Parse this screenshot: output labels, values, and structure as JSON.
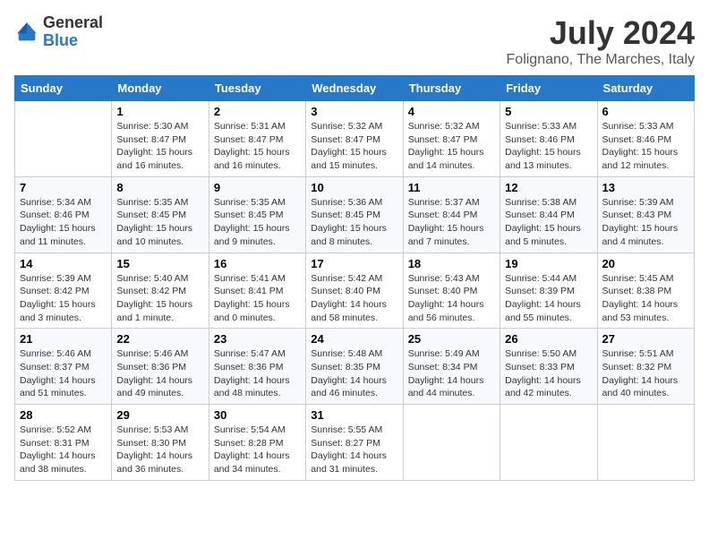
{
  "header": {
    "logo_general": "General",
    "logo_blue": "Blue",
    "month_year": "July 2024",
    "location": "Folignano, The Marches, Italy"
  },
  "weekdays": [
    "Sunday",
    "Monday",
    "Tuesday",
    "Wednesday",
    "Thursday",
    "Friday",
    "Saturday"
  ],
  "weeks": [
    [
      {
        "day": "",
        "sunrise": "",
        "sunset": "",
        "daylight": ""
      },
      {
        "day": "1",
        "sunrise": "Sunrise: 5:30 AM",
        "sunset": "Sunset: 8:47 PM",
        "daylight": "Daylight: 15 hours and 16 minutes."
      },
      {
        "day": "2",
        "sunrise": "Sunrise: 5:31 AM",
        "sunset": "Sunset: 8:47 PM",
        "daylight": "Daylight: 15 hours and 16 minutes."
      },
      {
        "day": "3",
        "sunrise": "Sunrise: 5:32 AM",
        "sunset": "Sunset: 8:47 PM",
        "daylight": "Daylight: 15 hours and 15 minutes."
      },
      {
        "day": "4",
        "sunrise": "Sunrise: 5:32 AM",
        "sunset": "Sunset: 8:47 PM",
        "daylight": "Daylight: 15 hours and 14 minutes."
      },
      {
        "day": "5",
        "sunrise": "Sunrise: 5:33 AM",
        "sunset": "Sunset: 8:46 PM",
        "daylight": "Daylight: 15 hours and 13 minutes."
      },
      {
        "day": "6",
        "sunrise": "Sunrise: 5:33 AM",
        "sunset": "Sunset: 8:46 PM",
        "daylight": "Daylight: 15 hours and 12 minutes."
      }
    ],
    [
      {
        "day": "7",
        "sunrise": "Sunrise: 5:34 AM",
        "sunset": "Sunset: 8:46 PM",
        "daylight": "Daylight: 15 hours and 11 minutes."
      },
      {
        "day": "8",
        "sunrise": "Sunrise: 5:35 AM",
        "sunset": "Sunset: 8:45 PM",
        "daylight": "Daylight: 15 hours and 10 minutes."
      },
      {
        "day": "9",
        "sunrise": "Sunrise: 5:35 AM",
        "sunset": "Sunset: 8:45 PM",
        "daylight": "Daylight: 15 hours and 9 minutes."
      },
      {
        "day": "10",
        "sunrise": "Sunrise: 5:36 AM",
        "sunset": "Sunset: 8:45 PM",
        "daylight": "Daylight: 15 hours and 8 minutes."
      },
      {
        "day": "11",
        "sunrise": "Sunrise: 5:37 AM",
        "sunset": "Sunset: 8:44 PM",
        "daylight": "Daylight: 15 hours and 7 minutes."
      },
      {
        "day": "12",
        "sunrise": "Sunrise: 5:38 AM",
        "sunset": "Sunset: 8:44 PM",
        "daylight": "Daylight: 15 hours and 5 minutes."
      },
      {
        "day": "13",
        "sunrise": "Sunrise: 5:39 AM",
        "sunset": "Sunset: 8:43 PM",
        "daylight": "Daylight: 15 hours and 4 minutes."
      }
    ],
    [
      {
        "day": "14",
        "sunrise": "Sunrise: 5:39 AM",
        "sunset": "Sunset: 8:42 PM",
        "daylight": "Daylight: 15 hours and 3 minutes."
      },
      {
        "day": "15",
        "sunrise": "Sunrise: 5:40 AM",
        "sunset": "Sunset: 8:42 PM",
        "daylight": "Daylight: 15 hours and 1 minute."
      },
      {
        "day": "16",
        "sunrise": "Sunrise: 5:41 AM",
        "sunset": "Sunset: 8:41 PM",
        "daylight": "Daylight: 15 hours and 0 minutes."
      },
      {
        "day": "17",
        "sunrise": "Sunrise: 5:42 AM",
        "sunset": "Sunset: 8:40 PM",
        "daylight": "Daylight: 14 hours and 58 minutes."
      },
      {
        "day": "18",
        "sunrise": "Sunrise: 5:43 AM",
        "sunset": "Sunset: 8:40 PM",
        "daylight": "Daylight: 14 hours and 56 minutes."
      },
      {
        "day": "19",
        "sunrise": "Sunrise: 5:44 AM",
        "sunset": "Sunset: 8:39 PM",
        "daylight": "Daylight: 14 hours and 55 minutes."
      },
      {
        "day": "20",
        "sunrise": "Sunrise: 5:45 AM",
        "sunset": "Sunset: 8:38 PM",
        "daylight": "Daylight: 14 hours and 53 minutes."
      }
    ],
    [
      {
        "day": "21",
        "sunrise": "Sunrise: 5:46 AM",
        "sunset": "Sunset: 8:37 PM",
        "daylight": "Daylight: 14 hours and 51 minutes."
      },
      {
        "day": "22",
        "sunrise": "Sunrise: 5:46 AM",
        "sunset": "Sunset: 8:36 PM",
        "daylight": "Daylight: 14 hours and 49 minutes."
      },
      {
        "day": "23",
        "sunrise": "Sunrise: 5:47 AM",
        "sunset": "Sunset: 8:36 PM",
        "daylight": "Daylight: 14 hours and 48 minutes."
      },
      {
        "day": "24",
        "sunrise": "Sunrise: 5:48 AM",
        "sunset": "Sunset: 8:35 PM",
        "daylight": "Daylight: 14 hours and 46 minutes."
      },
      {
        "day": "25",
        "sunrise": "Sunrise: 5:49 AM",
        "sunset": "Sunset: 8:34 PM",
        "daylight": "Daylight: 14 hours and 44 minutes."
      },
      {
        "day": "26",
        "sunrise": "Sunrise: 5:50 AM",
        "sunset": "Sunset: 8:33 PM",
        "daylight": "Daylight: 14 hours and 42 minutes."
      },
      {
        "day": "27",
        "sunrise": "Sunrise: 5:51 AM",
        "sunset": "Sunset: 8:32 PM",
        "daylight": "Daylight: 14 hours and 40 minutes."
      }
    ],
    [
      {
        "day": "28",
        "sunrise": "Sunrise: 5:52 AM",
        "sunset": "Sunset: 8:31 PM",
        "daylight": "Daylight: 14 hours and 38 minutes."
      },
      {
        "day": "29",
        "sunrise": "Sunrise: 5:53 AM",
        "sunset": "Sunset: 8:30 PM",
        "daylight": "Daylight: 14 hours and 36 minutes."
      },
      {
        "day": "30",
        "sunrise": "Sunrise: 5:54 AM",
        "sunset": "Sunset: 8:28 PM",
        "daylight": "Daylight: 14 hours and 34 minutes."
      },
      {
        "day": "31",
        "sunrise": "Sunrise: 5:55 AM",
        "sunset": "Sunset: 8:27 PM",
        "daylight": "Daylight: 14 hours and 31 minutes."
      },
      {
        "day": "",
        "sunrise": "",
        "sunset": "",
        "daylight": ""
      },
      {
        "day": "",
        "sunrise": "",
        "sunset": "",
        "daylight": ""
      },
      {
        "day": "",
        "sunrise": "",
        "sunset": "",
        "daylight": ""
      }
    ]
  ]
}
